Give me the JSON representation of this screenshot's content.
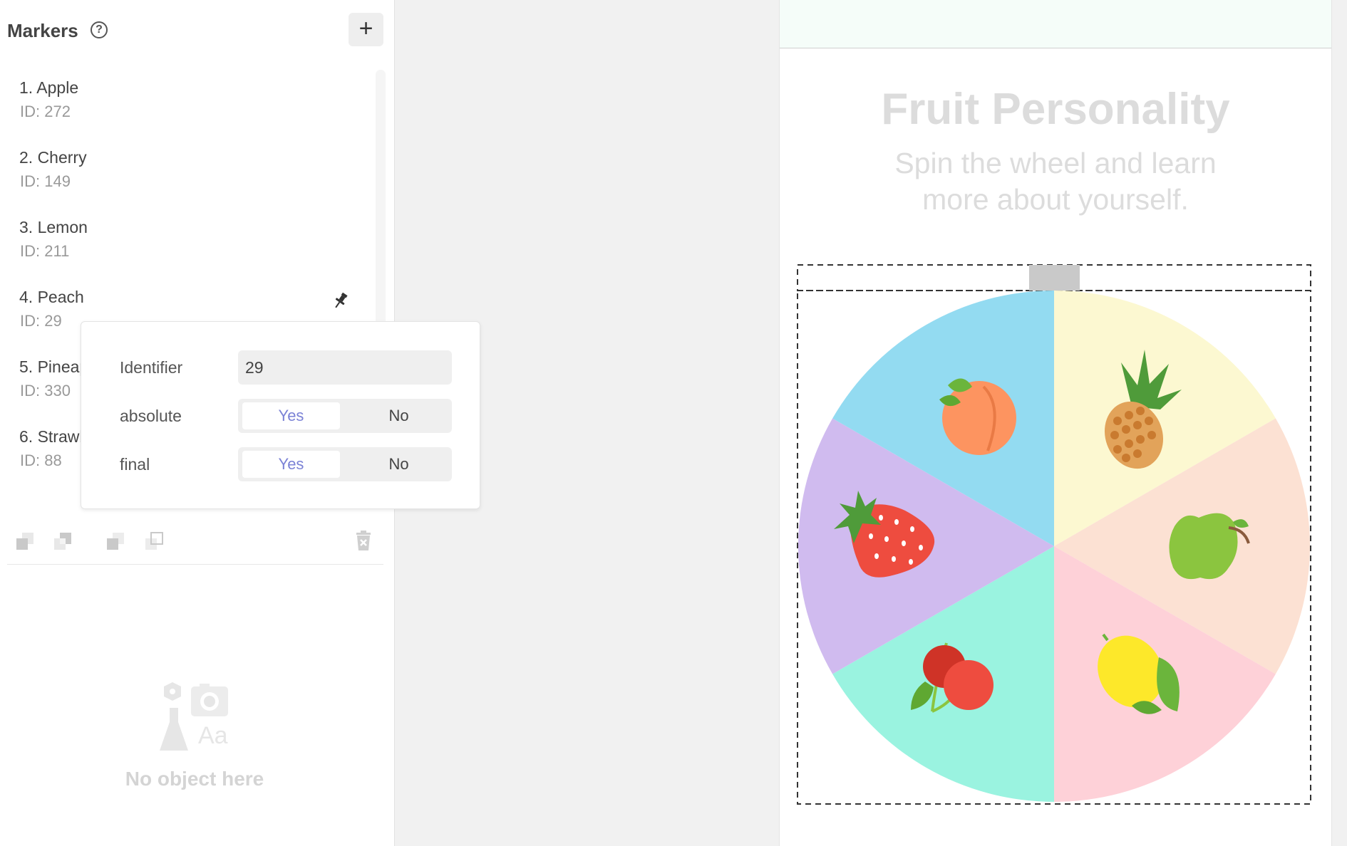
{
  "panel": {
    "title": "Markers",
    "help_icon": "question-circle-icon",
    "add_icon": "plus-icon"
  },
  "markers": [
    {
      "name": "1. Apple",
      "id": "ID: 272"
    },
    {
      "name": "2. Cherry",
      "id": "ID: 149"
    },
    {
      "name": "3. Lemon",
      "id": "ID: 211"
    },
    {
      "name": "4. Peach",
      "id": "ID: 29"
    },
    {
      "name": "5. Pineap",
      "id": "ID: 330"
    },
    {
      "name": "6. Strawb",
      "id": "ID: 88"
    }
  ],
  "popover": {
    "identifier_label": "Identifier",
    "identifier_value": "29",
    "absolute_label": "absolute",
    "final_label": "final",
    "yes_label": "Yes",
    "no_label": "No",
    "absolute_selected": "Yes",
    "final_selected": "Yes"
  },
  "toolbar": {
    "icons": [
      "send-to-back-icon",
      "send-backward-icon",
      "bring-forward-icon",
      "bring-to-front-icon",
      "delete-icon"
    ]
  },
  "empty_state": {
    "text": "No object here",
    "icon": "objects-placeholder-icon"
  },
  "preview": {
    "title": "Fruit Personality",
    "subtitle": "Spin the wheel and learn more about yourself."
  },
  "wheel": {
    "segments": [
      {
        "fruit": "pineapple",
        "color": "#fcf8d1"
      },
      {
        "fruit": "apple",
        "color": "#fce1d3"
      },
      {
        "fruit": "lemon",
        "color": "#fed1d8"
      },
      {
        "fruit": "cherry",
        "color": "#9af3e0"
      },
      {
        "fruit": "strawberry",
        "color": "#d0bbef"
      },
      {
        "fruit": "peach",
        "color": "#93dbf1"
      }
    ]
  }
}
